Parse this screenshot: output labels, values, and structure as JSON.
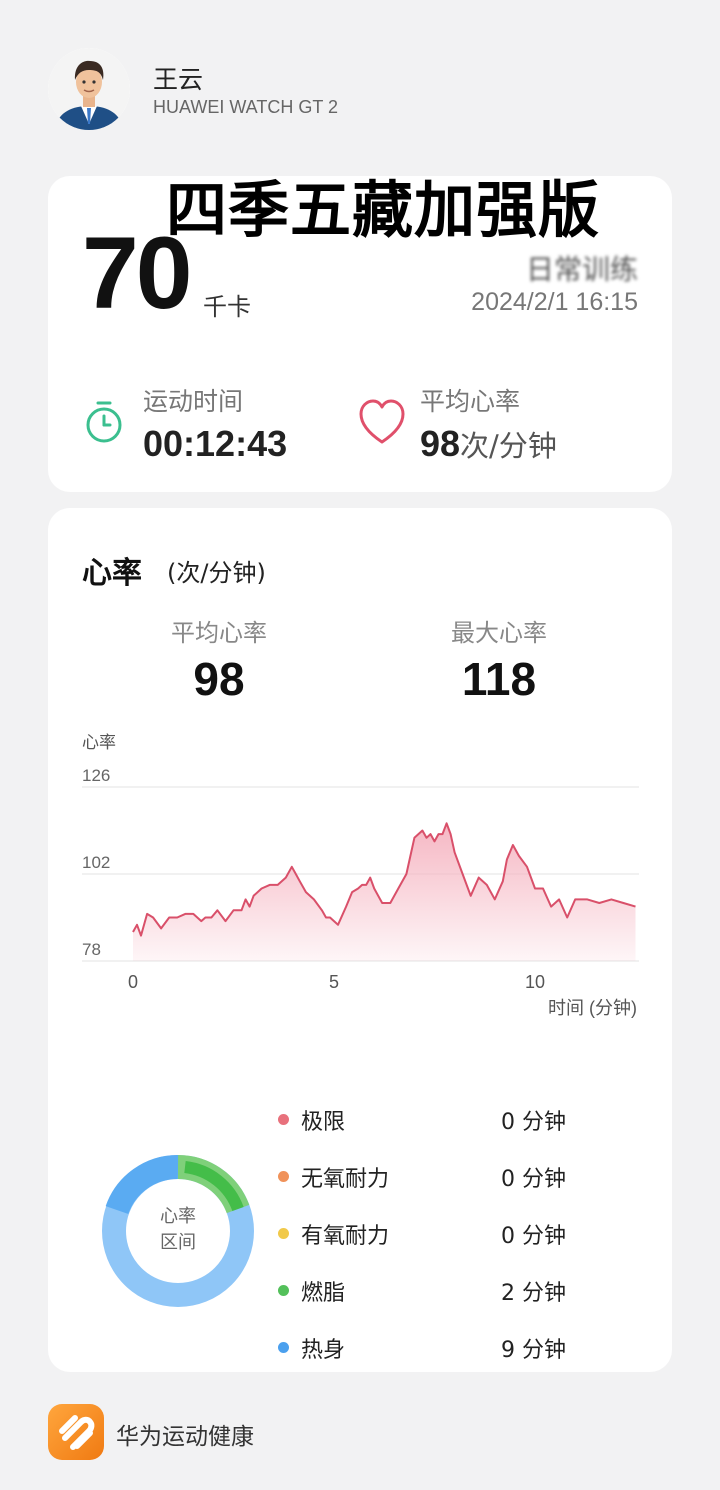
{
  "user": {
    "name": "王云",
    "device": "HUAWEI WATCH GT 2"
  },
  "overlay_title": "四季五藏加强版",
  "summary": {
    "calories_value": "70",
    "calories_unit": "千卡",
    "workout_type": "日常训练",
    "datetime": "2024/2/1 16:15",
    "duration_label": "运动时间",
    "duration_value": "00:12:43",
    "avg_hr_label": "平均心率",
    "avg_hr_value": "98",
    "avg_hr_unit": "次/分钟"
  },
  "heart_rate": {
    "title": "心率",
    "unit": "(次/分钟)",
    "avg_label": "平均心率",
    "avg_value": "98",
    "max_label": "最大心率",
    "max_value": "118"
  },
  "chart_data": {
    "type": "area",
    "ylabel": "心率",
    "xlabel": "时间 (分钟)",
    "xlim": [
      0,
      12.5
    ],
    "ylim": [
      78,
      126
    ],
    "yticks": [
      "126",
      "102",
      "78"
    ],
    "xticks": [
      "0",
      "5",
      "10"
    ],
    "grid": true,
    "color": "#d9506a",
    "fill_color": "#f5b3c0",
    "x": [
      0,
      0.1,
      0.2,
      0.35,
      0.5,
      0.7,
      0.9,
      1.1,
      1.3,
      1.5,
      1.7,
      1.8,
      1.95,
      2.1,
      2.3,
      2.5,
      2.7,
      2.8,
      2.9,
      3.0,
      3.2,
      3.4,
      3.6,
      3.8,
      3.95,
      4.05,
      4.15,
      4.3,
      4.5,
      4.7,
      4.8,
      4.9,
      5.1,
      5.3,
      5.45,
      5.6,
      5.7,
      5.8,
      5.9,
      6.0,
      6.2,
      6.4,
      6.6,
      6.8,
      6.9,
      7.0,
      7.2,
      7.3,
      7.4,
      7.5,
      7.6,
      7.7,
      7.8,
      7.9,
      8.0,
      8.2,
      8.4,
      8.6,
      8.8,
      9.0,
      9.2,
      9.3,
      9.45,
      9.6,
      9.8,
      10.0,
      10.2,
      10.4,
      10.6,
      10.8,
      11.0,
      11.3,
      11.6,
      11.9,
      12.2,
      12.5
    ],
    "y": [
      86,
      88,
      85,
      91,
      90,
      87,
      90,
      90,
      91,
      91,
      89,
      90,
      90,
      92,
      89,
      92,
      92,
      95,
      93,
      96,
      98,
      99,
      99,
      101,
      104,
      102,
      100,
      97,
      95,
      92,
      90,
      90,
      88,
      93,
      97,
      98,
      99,
      99,
      101,
      98,
      94,
      94,
      98,
      102,
      107,
      112,
      114,
      112,
      113,
      111,
      113,
      113,
      116,
      113,
      108,
      102,
      96,
      101,
      99,
      95,
      100,
      106,
      110,
      107,
      104,
      98,
      98,
      93,
      95,
      90,
      95,
      95,
      94,
      95,
      94,
      93
    ]
  },
  "zones": [
    {
      "name": "极限",
      "minutes": "0 分钟",
      "color": "#e8717c"
    },
    {
      "name": "无氧耐力",
      "minutes": "0 分钟",
      "color": "#f0925a"
    },
    {
      "name": "有氧耐力",
      "minutes": "0 分钟",
      "color": "#f1c94a"
    },
    {
      "name": "燃脂",
      "minutes": "2 分钟",
      "color": "#53c05a"
    },
    {
      "name": "热身",
      "minutes": "9 分钟",
      "color": "#4ba0ee"
    }
  ],
  "donut": {
    "center_line1": "心率",
    "center_line2": "区间"
  },
  "app": {
    "name": "华为运动健康"
  }
}
